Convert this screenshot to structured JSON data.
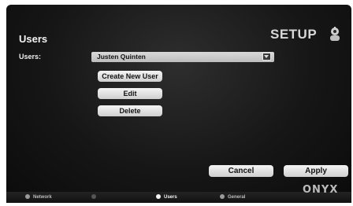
{
  "header": {
    "page_title": "Users",
    "section_title": "SETUP",
    "setup_icon": "gear-person-icon"
  },
  "users_field": {
    "label": "Users:",
    "selected_value": "Justen Quinten"
  },
  "actions": {
    "create_label": "Create New User",
    "edit_label": "Edit",
    "delete_label": "Delete"
  },
  "footer_buttons": {
    "cancel_label": "Cancel",
    "apply_label": "Apply"
  },
  "nav": {
    "items": [
      {
        "label": "Network"
      },
      {
        "label": ""
      },
      {
        "label": "Users"
      },
      {
        "label": "General"
      }
    ],
    "active": "Users"
  },
  "logo_text": "ONYX"
}
